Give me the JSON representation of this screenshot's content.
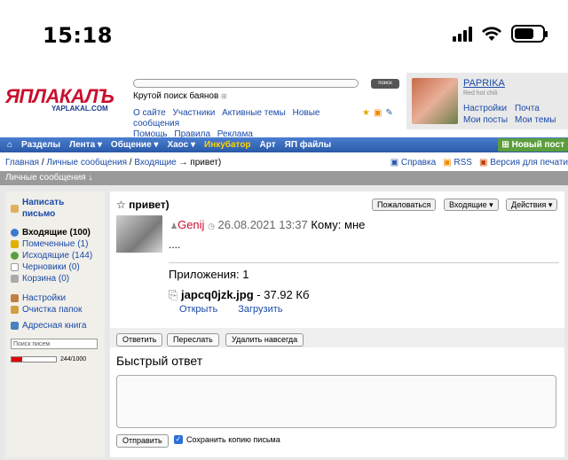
{
  "status": {
    "time": "15:18"
  },
  "logo": {
    "title": "ЯПЛАКАЛЪ",
    "subtitle": "YAPLAKAL.COM"
  },
  "header": {
    "search_button": "поиск",
    "search_hint": "Крутой поиск баянов",
    "links": [
      "О сайте",
      "Участники",
      "Активные темы",
      "Новые сообщения",
      "Помощь",
      "Правила",
      "Реклама"
    ]
  },
  "user": {
    "name": "PAPRIKA",
    "subtitle": "Red hot chili",
    "settings": "Настройки",
    "mail": "Почта",
    "my_posts": "Мои посты",
    "my_topics": "Мои темы"
  },
  "nav": {
    "items": [
      "Разделы",
      "Лента ▾",
      "Общение ▾",
      "Хаос ▾",
      "Инкубатор",
      "Арт",
      "ЯП файлы"
    ],
    "new_post": "Новый пост"
  },
  "breadcrumb": {
    "home": "Главная",
    "pm": "Личные сообщения",
    "inbox": "Входящие",
    "current": "→ привет)"
  },
  "crumb_right": {
    "help": "Справка",
    "rss": "RSS",
    "print": "Версия для печати"
  },
  "section": {
    "title": "Личные сообщения ↓"
  },
  "sidebar": {
    "compose": "Написать письмо",
    "inbox": "Входящие (100)",
    "marked": "Помеченные (1)",
    "outbox": "Исходящие (144)",
    "drafts": "Черновики (0)",
    "trash": "Корзина (0)",
    "settings": "Настройки",
    "clean": "Очистка папок",
    "addressbook": "Адресная книга",
    "search_placeholder": "Поиск писем",
    "quota": "244/1000"
  },
  "message": {
    "title": "привет)",
    "report": "Пожаловаться",
    "folder": "Входящие ▾",
    "actions": "Действия ▾",
    "sender": "Genij",
    "date": "26.08.2021 13:37",
    "to": "Кому: мне",
    "body": "....",
    "attachments_label": "Приложения: 1",
    "file_name": "japcq0jzk.jpg",
    "file_size": "- 37.92 Кб",
    "open": "Открыть",
    "download": "Загрузить"
  },
  "buttons": {
    "reply": "Ответить",
    "forward": "Переслать",
    "delete": "Удалить навсегда"
  },
  "quick_reply": {
    "title": "Быстрый ответ",
    "send": "Отправить",
    "keep_copy": "Сохранить копию письма"
  }
}
